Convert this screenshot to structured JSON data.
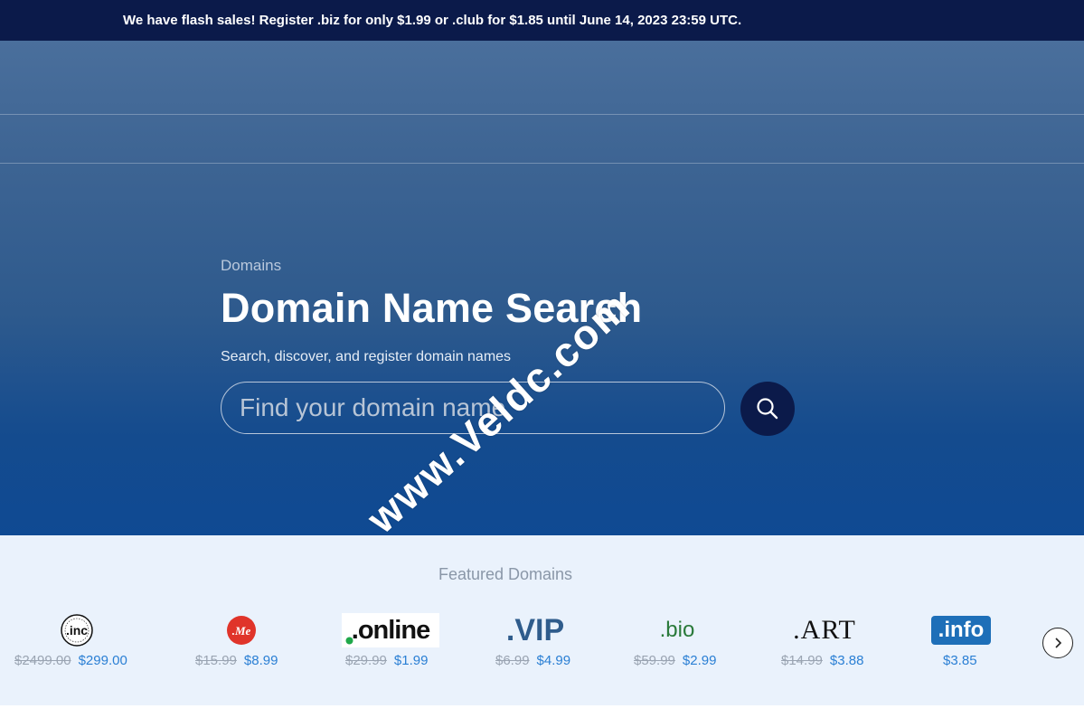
{
  "promo": {
    "text": "We have flash sales! Register .biz for only $1.99 or .club for $1.85 until June 14, 2023 23:59 UTC."
  },
  "hero": {
    "breadcrumb": "Domains",
    "title": "Domain Name Search",
    "subtitle": "Search, discover, and register domain names",
    "search_placeholder": "Find your domain name"
  },
  "watermark": "www.Veldc.com",
  "featured": {
    "title": "Featured Domains",
    "items": [
      {
        "tld": ".inc",
        "logo_text": ".inc",
        "old_price": "$2499.00",
        "new_price": "$299.00"
      },
      {
        "tld": ".me",
        "logo_text": ".Me",
        "old_price": "$15.99",
        "new_price": "$8.99"
      },
      {
        "tld": ".online",
        "logo_text": ".online",
        "old_price": "$29.99",
        "new_price": "$1.99"
      },
      {
        "tld": ".vip",
        "logo_text": ".VIP",
        "old_price": "$6.99",
        "new_price": "$4.99"
      },
      {
        "tld": ".bio",
        "logo_text": ".bio",
        "old_price": "$59.99",
        "new_price": "$2.99"
      },
      {
        "tld": ".art",
        "logo_text": ".ART",
        "old_price": "$14.99",
        "new_price": "$3.88"
      },
      {
        "tld": ".info",
        "logo_text": ".info",
        "old_price": "",
        "new_price": "$3.85"
      }
    ]
  },
  "colors": {
    "promo_bg": "#0b1a4a",
    "search_button_bg": "#0b1a4a",
    "price_accent": "#2a7fd4",
    "featured_bg": "#eaf2fc"
  },
  "icons": {
    "search": "search-icon",
    "next": "chevron-right-icon"
  }
}
